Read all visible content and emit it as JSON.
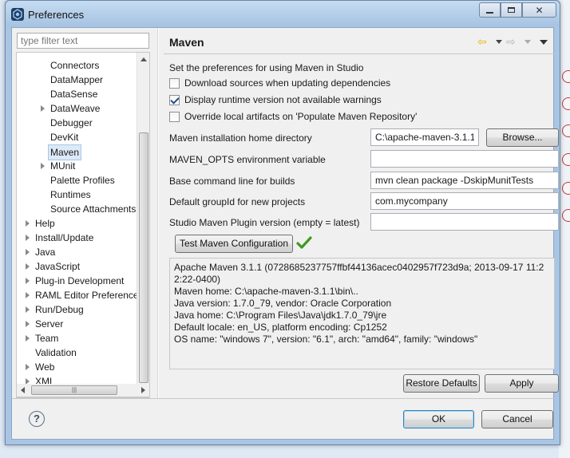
{
  "window": {
    "title": "Preferences"
  },
  "filter": {
    "placeholder": "type filter text"
  },
  "tree": [
    {
      "label": "Connectors",
      "indent": 2,
      "arrow": false
    },
    {
      "label": "DataMapper",
      "indent": 2,
      "arrow": false
    },
    {
      "label": "DataSense",
      "indent": 2,
      "arrow": false
    },
    {
      "label": "DataWeave",
      "indent": 2,
      "arrow": true
    },
    {
      "label": "Debugger",
      "indent": 2,
      "arrow": false
    },
    {
      "label": "DevKit",
      "indent": 2,
      "arrow": false
    },
    {
      "label": "Maven",
      "indent": 2,
      "arrow": false,
      "selected": true
    },
    {
      "label": "MUnit",
      "indent": 2,
      "arrow": true
    },
    {
      "label": "Palette Profiles",
      "indent": 2,
      "arrow": false
    },
    {
      "label": "Runtimes",
      "indent": 2,
      "arrow": false
    },
    {
      "label": "Source Attachments",
      "indent": 2,
      "arrow": false
    },
    {
      "label": "Help",
      "indent": 1,
      "arrow": true
    },
    {
      "label": "Install/Update",
      "indent": 1,
      "arrow": true
    },
    {
      "label": "Java",
      "indent": 1,
      "arrow": true
    },
    {
      "label": "JavaScript",
      "indent": 1,
      "arrow": true
    },
    {
      "label": "Plug-in Development",
      "indent": 1,
      "arrow": true
    },
    {
      "label": "RAML Editor Preferences",
      "indent": 1,
      "arrow": true
    },
    {
      "label": "Run/Debug",
      "indent": 1,
      "arrow": true
    },
    {
      "label": "Server",
      "indent": 1,
      "arrow": true
    },
    {
      "label": "Team",
      "indent": 1,
      "arrow": true
    },
    {
      "label": "Validation",
      "indent": 1,
      "arrow": false
    },
    {
      "label": "Web",
      "indent": 1,
      "arrow": true
    },
    {
      "label": "XML",
      "indent": 1,
      "arrow": true
    }
  ],
  "page": {
    "title": "Maven",
    "description": "Set the preferences for using Maven in Studio",
    "checkboxes": {
      "download_sources": {
        "label": "Download sources when updating dependencies",
        "checked": false
      },
      "display_runtime": {
        "label": "Display runtime version not available warnings",
        "checked": true
      },
      "override_local": {
        "label": "Override local artifacts on 'Populate Maven Repository'",
        "checked": false
      }
    },
    "fields": {
      "maven_home": {
        "label": "Maven installation home directory",
        "value": "C:\\apache-maven-3.1.1"
      },
      "maven_opts": {
        "label": "MAVEN_OPTS environment variable",
        "value": ""
      },
      "base_cmd": {
        "label": "Base command line for builds",
        "value": "mvn clean package -DskipMunitTests"
      },
      "group_id": {
        "label": "Default groupId for new projects",
        "value": "com.mycompany"
      },
      "plugin_version": {
        "label": "Studio Maven Plugin version (empty = latest)",
        "value": ""
      }
    },
    "browse_label": "Browse...",
    "test_label": "Test Maven Configuration",
    "output_lines": [
      "Apache Maven 3.1.1 (0728685237757ffbf44136acec0402957f723d9a; 2013-09-17 11:22:22-0400)",
      "Maven home: C:\\apache-maven-3.1.1\\bin\\..",
      "Java version: 1.7.0_79, vendor: Oracle Corporation",
      "Java home: C:\\Program Files\\Java\\jdk1.7.0_79\\jre",
      "Default locale: en_US, platform encoding: Cp1252",
      "OS name: \"windows 7\", version: \"6.1\", arch: \"amd64\", family: \"windows\""
    ],
    "restore_label": "Restore Defaults",
    "apply_label": "Apply"
  },
  "dialog": {
    "help": "?",
    "ok_label": "OK",
    "cancel_label": "Cancel"
  },
  "colors": {
    "accent_nav": "#e8b400",
    "check_ok": "#3f9a1c",
    "selection": "#dce9f7"
  },
  "icons": {
    "app": "mule-studio-icon",
    "back": "back-arrow-icon",
    "forward": "forward-arrow-icon",
    "menu": "view-menu-icon",
    "success": "checkmark-icon",
    "help": "help-icon"
  }
}
